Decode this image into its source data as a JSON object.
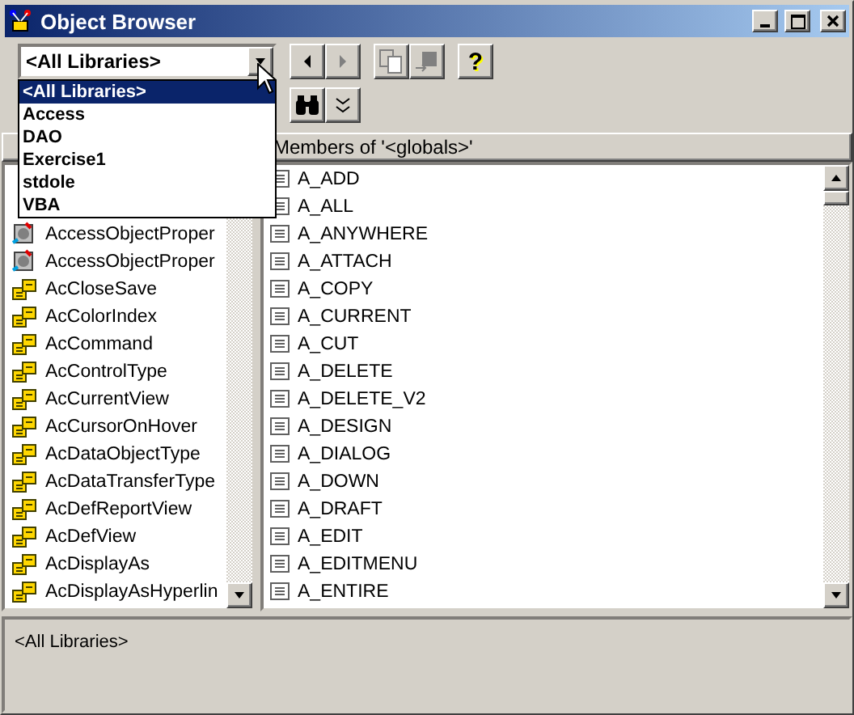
{
  "window": {
    "title": "Object Browser"
  },
  "library_combo": {
    "value": "<All Libraries>",
    "expanded": true,
    "options": [
      {
        "label": "<All Libraries>",
        "selected": true
      },
      {
        "label": "Access",
        "selected": false
      },
      {
        "label": "DAO",
        "selected": false
      },
      {
        "label": "Exercise1",
        "selected": false
      },
      {
        "label": "stdole",
        "selected": false
      },
      {
        "label": "VBA",
        "selected": false
      }
    ]
  },
  "help_button": {
    "label": "?"
  },
  "members_header": "Members of '<globals>'",
  "classes": [
    {
      "name": "AccessObjectProper",
      "kind": "module"
    },
    {
      "name": "AccessObjectProper",
      "kind": "module"
    },
    {
      "name": "AcCloseSave",
      "kind": "enum"
    },
    {
      "name": "AcColorIndex",
      "kind": "enum"
    },
    {
      "name": "AcCommand",
      "kind": "enum"
    },
    {
      "name": "AcControlType",
      "kind": "enum"
    },
    {
      "name": "AcCurrentView",
      "kind": "enum"
    },
    {
      "name": "AcCursorOnHover",
      "kind": "enum"
    },
    {
      "name": "AcDataObjectType",
      "kind": "enum"
    },
    {
      "name": "AcDataTransferType",
      "kind": "enum"
    },
    {
      "name": "AcDefReportView",
      "kind": "enum"
    },
    {
      "name": "AcDefView",
      "kind": "enum"
    },
    {
      "name": "AcDisplayAs",
      "kind": "enum"
    },
    {
      "name": "AcDisplayAsHyperlin",
      "kind": "enum"
    }
  ],
  "members": [
    "A_ADD",
    "A_ALL",
    "A_ANYWHERE",
    "A_ATTACH",
    "A_COPY",
    "A_CURRENT",
    "A_CUT",
    "A_DELETE",
    "A_DELETE_V2",
    "A_DESIGN",
    "A_DIALOG",
    "A_DOWN",
    "A_DRAFT",
    "A_EDIT",
    "A_EDITMENU",
    "A_ENTIRE"
  ],
  "details": "<All Libraries>"
}
